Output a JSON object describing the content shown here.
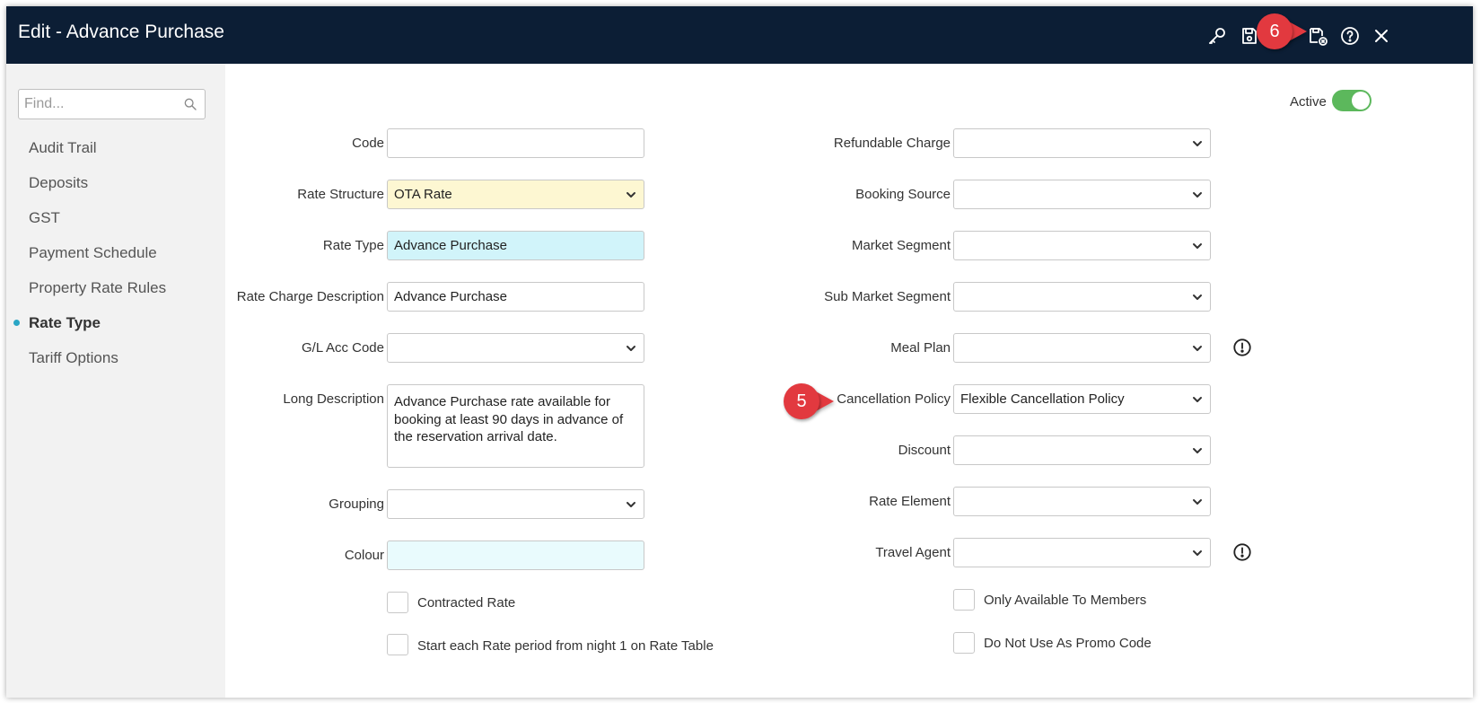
{
  "window": {
    "title": "Edit - Advance Purchase"
  },
  "titlebar_icons": [
    "key-icon",
    "save-icon",
    "save-close-icon",
    "help-icon",
    "close-icon"
  ],
  "sidebar": {
    "search_placeholder": "Find...",
    "items": [
      {
        "label": "Audit Trail",
        "active": false
      },
      {
        "label": "Deposits",
        "active": false
      },
      {
        "label": "GST",
        "active": false
      },
      {
        "label": "Payment Schedule",
        "active": false
      },
      {
        "label": "Property Rate Rules",
        "active": false
      },
      {
        "label": "Rate Type",
        "active": true
      },
      {
        "label": "Tariff Options",
        "active": false
      }
    ]
  },
  "active_toggle": {
    "label": "Active",
    "on": true
  },
  "left_form": {
    "code": {
      "label": "Code",
      "value": ""
    },
    "rate_structure": {
      "label": "Rate Structure",
      "value": "OTA Rate"
    },
    "rate_type": {
      "label": "Rate Type",
      "value": "Advance Purchase"
    },
    "rate_charge_description": {
      "label": "Rate Charge Description",
      "value": "Advance Purchase"
    },
    "gl_acc_code": {
      "label": "G/L Acc Code",
      "value": ""
    },
    "long_description": {
      "label": "Long Description",
      "value": "Advance Purchase rate available for booking at least 90 days in advance of the reservation arrival date."
    },
    "grouping": {
      "label": "Grouping",
      "value": ""
    },
    "colour": {
      "label": "Colour",
      "value": ""
    },
    "contracted_rate": {
      "label": "Contracted Rate",
      "checked": false
    },
    "start_each_rate_period": {
      "label": "Start each Rate period from night 1 on Rate Table",
      "checked": false
    }
  },
  "right_form": {
    "refundable_charge": {
      "label": "Refundable Charge",
      "value": ""
    },
    "booking_source": {
      "label": "Booking Source",
      "value": ""
    },
    "market_segment": {
      "label": "Market Segment",
      "value": ""
    },
    "sub_market_segment": {
      "label": "Sub Market Segment",
      "value": ""
    },
    "meal_plan": {
      "label": "Meal Plan",
      "value": ""
    },
    "cancellation_policy": {
      "label": "Cancellation Policy",
      "value": "Flexible Cancellation Policy"
    },
    "discount": {
      "label": "Discount",
      "value": ""
    },
    "rate_element": {
      "label": "Rate Element",
      "value": ""
    },
    "travel_agent": {
      "label": "Travel Agent",
      "value": ""
    },
    "only_available_to_members": {
      "label": "Only Available To Members",
      "checked": false
    },
    "do_not_use_as_promo_code": {
      "label": "Do Not Use As Promo Code",
      "checked": false
    }
  },
  "annotations": {
    "step5": "5",
    "step6": "6"
  },
  "colors": {
    "titlebar": "#0c1e35",
    "toggle_on": "#5cb85c",
    "badge": "#e2393f",
    "active_dot": "#2aa6c5",
    "rate_structure_bg": "#fdf7d2",
    "rate_type_bg": "#d1f4fa"
  }
}
